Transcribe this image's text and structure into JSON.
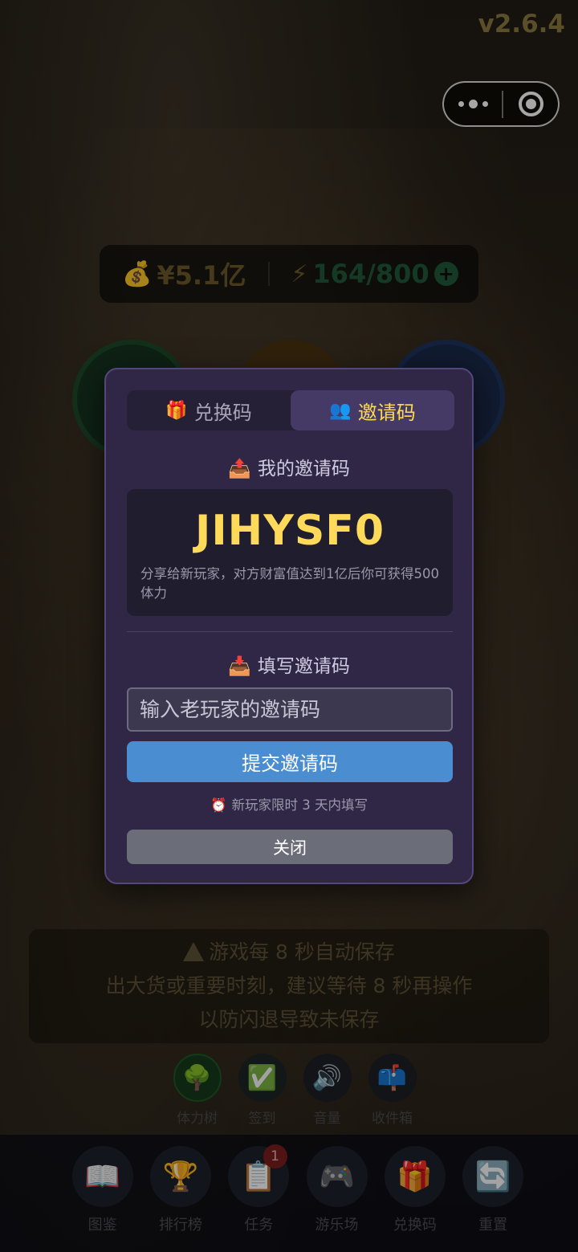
{
  "version": "v2.6.4",
  "capsule": {
    "more_icon": "more-dots-icon",
    "close_icon": "target-icon"
  },
  "stats": {
    "money": "¥5.1亿",
    "energy": "164/800",
    "money_icon": "money-bag-icon",
    "energy_icon": "lightning-icon",
    "plus": "+"
  },
  "warning": {
    "line1": "游戏每 8 秒自动保存",
    "line2": "出大货或重要时刻，建议等待 8 秒再操作",
    "line3": "以防闪退导致未保存"
  },
  "mini_buttons": [
    {
      "label": "体力树",
      "icon": "tree-icon"
    },
    {
      "label": "签到",
      "icon": "checkmark-icon"
    },
    {
      "label": "音量",
      "icon": "speaker-icon"
    },
    {
      "label": "收件箱",
      "icon": "mailbox-icon"
    }
  ],
  "dock": [
    {
      "label": "图鉴",
      "icon": "book-icon"
    },
    {
      "label": "排行榜",
      "icon": "trophy-icon"
    },
    {
      "label": "任务",
      "icon": "clipboard-icon",
      "badge": "1"
    },
    {
      "label": "游乐场",
      "icon": "gamepad-icon"
    },
    {
      "label": "兑换码",
      "icon": "gift-icon"
    },
    {
      "label": "重置",
      "icon": "refresh-icon"
    }
  ],
  "modal": {
    "tabs": [
      {
        "label": "兑换码",
        "icon": "gift-icon",
        "active": false
      },
      {
        "label": "邀请码",
        "icon": "people-icon",
        "active": true
      }
    ],
    "my_code_title": "我的邀请码",
    "my_code": "JIHYSF0",
    "my_code_desc": "分享给新玩家，对方财富值达到1亿后你可获得500 体力",
    "fill_title": "填写邀请码",
    "input_placeholder": "输入老玩家的邀请码",
    "submit_label": "提交邀请码",
    "hint": "新玩家限时 3 天内填写",
    "close_label": "关闭"
  },
  "colors": {
    "accent": "#ffd95a",
    "submit": "#4a8ed1",
    "modal_bg": "#2f2745",
    "active_tab": "#453a66"
  }
}
